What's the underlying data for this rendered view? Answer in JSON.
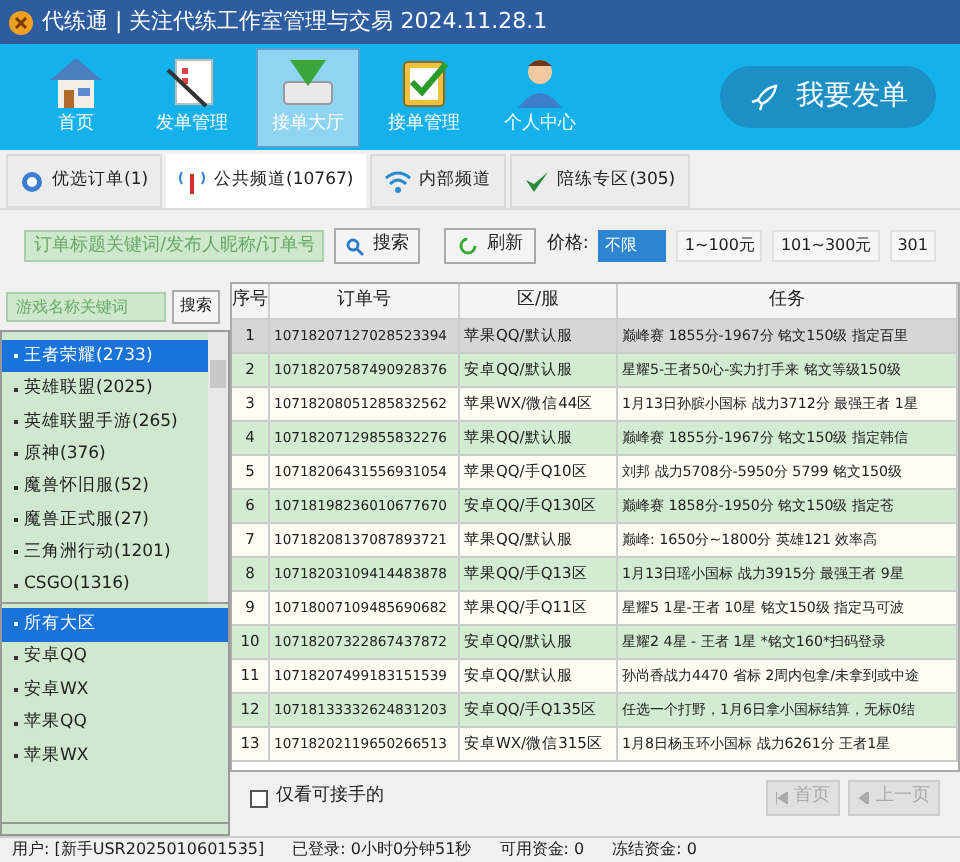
{
  "window": {
    "title": "代练通 | 关注代练工作室管理与交易 2024.11.28.1"
  },
  "nav": [
    {
      "label": "首页",
      "kind": "home",
      "selected": false
    },
    {
      "label": "发单管理",
      "kind": "post",
      "selected": false
    },
    {
      "label": "接单大厅",
      "kind": "hall",
      "selected": true
    },
    {
      "label": "接单管理",
      "kind": "manage",
      "selected": false
    },
    {
      "label": "个人中心",
      "kind": "user",
      "selected": false
    }
  ],
  "post_button": "我要发单",
  "tabs": [
    {
      "label": "优选订单(1)",
      "kind": "star",
      "selected": false
    },
    {
      "label": "公共频道(10767)",
      "kind": "signal",
      "selected": true
    },
    {
      "label": "内部频道",
      "kind": "wifi",
      "selected": false
    },
    {
      "label": "陪练专区(305)",
      "kind": "check",
      "selected": false
    }
  ],
  "search": {
    "placeholder": "订单标题关键词/发布人昵称/订单号",
    "button": "搜索"
  },
  "refresh_button": "刷新",
  "price": {
    "label": "价格:",
    "options": [
      {
        "label": "不限",
        "selected": true
      },
      {
        "label": "1~100元",
        "selected": false
      },
      {
        "label": "101~300元",
        "selected": false
      },
      {
        "label": "301",
        "selected": false
      }
    ]
  },
  "game_search": {
    "placeholder": "游戏名称关键词",
    "button": "搜索"
  },
  "games": [
    {
      "label": "王者荣耀(2733)",
      "selected": true
    },
    {
      "label": "英雄联盟(2025)",
      "selected": false
    },
    {
      "label": "英雄联盟手游(265)",
      "selected": false
    },
    {
      "label": "原神(376)",
      "selected": false
    },
    {
      "label": "魔兽怀旧服(52)",
      "selected": false
    },
    {
      "label": "魔兽正式服(27)",
      "selected": false
    },
    {
      "label": "三角洲行动(1201)",
      "selected": false
    },
    {
      "label": "CSGO(1316)",
      "selected": false
    }
  ],
  "regions": [
    {
      "label": "所有大区",
      "selected": true
    },
    {
      "label": "安卓QQ",
      "selected": false
    },
    {
      "label": "安卓WX",
      "selected": false
    },
    {
      "label": "苹果QQ",
      "selected": false
    },
    {
      "label": "苹果WX",
      "selected": false
    }
  ],
  "table": {
    "columns": [
      "序号",
      "订单号",
      "区/服",
      "任务"
    ],
    "rows": [
      {
        "cells": [
          "1",
          "10718207127028523394",
          "苹果QQ/默认服",
          "巅峰赛 1855分-1967分 铭文150级 指定百里"
        ],
        "selected": true
      },
      {
        "cells": [
          "2",
          "10718207587490928376",
          "安卓QQ/默认服",
          "星耀5-王者50心-实力打手来 铭文等级150级"
        ],
        "selected": false
      },
      {
        "cells": [
          "3",
          "10718208051285832562",
          "苹果WX/微信44区",
          "1月13日孙膑小国标 战力3712分 最强王者 1星"
        ],
        "selected": false
      },
      {
        "cells": [
          "4",
          "10718207129855832276",
          "苹果QQ/默认服",
          "巅峰赛 1855分-1967分 铭文150级 指定韩信"
        ],
        "selected": false
      },
      {
        "cells": [
          "5",
          "10718206431556931054",
          "苹果QQ/手Q10区",
          "刘邦 战力5708分-5950分 5799 铭文150级"
        ],
        "selected": false
      },
      {
        "cells": [
          "6",
          "10718198236010677670",
          "安卓QQ/手Q130区",
          "巅峰赛 1858分-1950分 铭文150级 指定苍"
        ],
        "selected": false
      },
      {
        "cells": [
          "7",
          "10718208137087893721",
          "苹果QQ/默认服",
          "巅峰: 1650分~1800分 英雄121 效率高"
        ],
        "selected": false
      },
      {
        "cells": [
          "8",
          "10718203109414483878",
          "苹果QQ/手Q13区",
          "1月13日瑶小国标 战力3915分 最强王者 9星"
        ],
        "selected": false
      },
      {
        "cells": [
          "9",
          "10718007109485690682",
          "苹果QQ/手Q11区",
          "星耀5 1星-王者 10星 铭文150级 指定马可波"
        ],
        "selected": false
      },
      {
        "cells": [
          "10",
          "10718207322867437872",
          "安卓QQ/默认服",
          "星耀2 4星 - 王者 1星 *铭文160*扫码登录"
        ],
        "selected": false
      },
      {
        "cells": [
          "11",
          "10718207499183151539",
          "安卓QQ/默认服",
          "孙尚香战力4470 省标 2周内包拿/未拿到或中途"
        ],
        "selected": false
      },
      {
        "cells": [
          "12",
          "10718133332624831203",
          "安卓QQ/手Q135区",
          "任选一个打野，1月6日拿小国标结算，无标0结"
        ],
        "selected": false
      },
      {
        "cells": [
          "13",
          "10718202119650266513",
          "安卓WX/微信315区",
          "1月8日杨玉环小国标 战力6261分 王者1星"
        ],
        "selected": false
      }
    ]
  },
  "only_available": {
    "label": "仅看可接手的",
    "checked": false
  },
  "pager": [
    {
      "label": "首页",
      "disabled": true
    },
    {
      "label": "上一页",
      "disabled": true
    }
  ],
  "status_bar": [
    "用户: [新手USR2025010601535]",
    "已登录: 0小时0分钟51秒",
    "可用资金: 0",
    "冻结资金: 0"
  ]
}
